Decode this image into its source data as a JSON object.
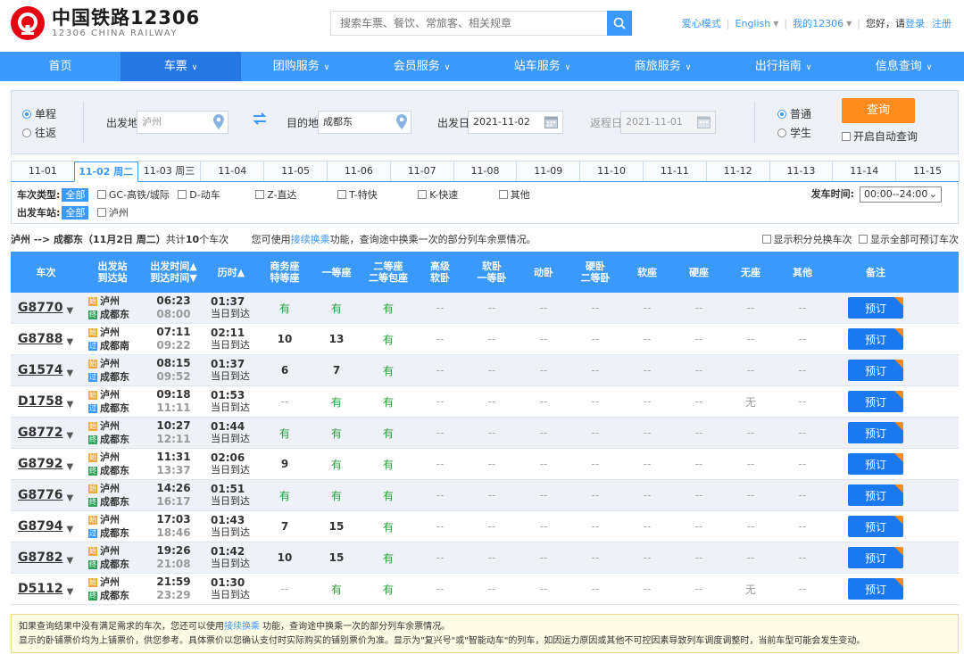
{
  "header": {
    "logo_cn": "中国铁路12306",
    "logo_en": "12306 CHINA RAILWAY",
    "search_placeholder": "搜索车票、餐饮、常旅客、相关规章",
    "links": {
      "care": "爱心模式",
      "english": "English",
      "my12306": "我的12306",
      "hello": "您好，请",
      "login": "登录",
      "register": "注册"
    }
  },
  "nav": [
    {
      "label": "首页",
      "dropdown": false
    },
    {
      "label": "车票",
      "dropdown": true,
      "active": true
    },
    {
      "label": "团购服务",
      "dropdown": true
    },
    {
      "label": "会员服务",
      "dropdown": true
    },
    {
      "label": "站车服务",
      "dropdown": true
    },
    {
      "label": "商旅服务",
      "dropdown": true
    },
    {
      "label": "出行指南",
      "dropdown": true
    },
    {
      "label": "信息查询",
      "dropdown": true
    }
  ],
  "query": {
    "oneway": "单程",
    "roundtrip": "往返",
    "from_label": "出发地",
    "from_value": "泸州",
    "to_label": "目的地",
    "to_value": "成都东",
    "depart_label": "出发日",
    "depart_value": "2021-11-02",
    "return_label": "返程日",
    "return_value": "2021-11-01",
    "normal": "普通",
    "student": "学生",
    "query_btn": "查询",
    "auto_query": "开启自动查询"
  },
  "dates": [
    "11-01",
    "11-02 周二",
    "11-03 周三",
    "11-04",
    "11-05",
    "11-06",
    "11-07",
    "11-08",
    "11-09",
    "11-10",
    "11-11",
    "11-12",
    "11-13",
    "11-14",
    "11-15"
  ],
  "filters": {
    "type_label": "车次类型:",
    "all": "全部",
    "types": [
      "GC-高铁/城际",
      "D-动车",
      "Z-直达",
      "T-特快",
      "K-快速",
      "其他"
    ],
    "station_label": "出发车站:",
    "station": "泸州",
    "time_label": "发车时间:",
    "time_value": "00:00--24:00"
  },
  "summary": {
    "route": "泸州 --> 成都东（11月2日 周二）",
    "count_pre": "共计",
    "count": "10",
    "count_post": "个车次",
    "hint_pre": "您可使用",
    "hint_link": "接续换乘",
    "hint_post": "功能，查询途中换乘一次的部分列车余票情况。",
    "opt1": "显示积分兑换车次",
    "opt2": "显示全部可预订车次"
  },
  "columns": [
    [
      "车次"
    ],
    [
      "出发站",
      "到达站"
    ],
    [
      "出发时间▲",
      "到达时间▼"
    ],
    [
      "历时▲"
    ],
    [
      "商务座",
      "特等座"
    ],
    [
      "一等座"
    ],
    [
      "二等座",
      "二等包座"
    ],
    [
      "高级",
      "软卧"
    ],
    [
      "软卧",
      "一等卧"
    ],
    [
      "动卧"
    ],
    [
      "硬卧",
      "二等卧"
    ],
    [
      "软座"
    ],
    [
      "硬座"
    ],
    [
      "无座"
    ],
    [
      "其他"
    ],
    [
      "备注"
    ]
  ],
  "book_label": "预订",
  "rows": [
    {
      "train": "G8770",
      "from": "泸州",
      "to": "成都东",
      "to_type": "end",
      "dep": "06:23",
      "arr": "08:00",
      "dur": "01:37",
      "arrive": "当日到达",
      "seats": [
        "有",
        "有",
        "有",
        "--",
        "--",
        "--",
        "--",
        "--",
        "--",
        "--",
        "--"
      ]
    },
    {
      "train": "G8788",
      "from": "泸州",
      "to": "成都南",
      "to_type": "pass",
      "dep": "07:11",
      "arr": "09:22",
      "dur": "02:11",
      "arrive": "当日到达",
      "seats": [
        "10",
        "13",
        "有",
        "--",
        "--",
        "--",
        "--",
        "--",
        "--",
        "--",
        "--"
      ]
    },
    {
      "train": "G1574",
      "from": "泸州",
      "to": "成都东",
      "to_type": "pass",
      "dep": "08:15",
      "arr": "09:52",
      "dur": "01:37",
      "arrive": "当日到达",
      "seats": [
        "6",
        "7",
        "有",
        "--",
        "--",
        "--",
        "--",
        "--",
        "--",
        "--",
        "--"
      ]
    },
    {
      "train": "D1758",
      "from": "泸州",
      "to": "成都东",
      "to_type": "pass",
      "dep": "09:18",
      "arr": "11:11",
      "dur": "01:53",
      "arrive": "当日到达",
      "seats": [
        "--",
        "有",
        "有",
        "--",
        "--",
        "--",
        "--",
        "--",
        "--",
        "无",
        "--"
      ]
    },
    {
      "train": "G8772",
      "from": "泸州",
      "to": "成都东",
      "to_type": "end",
      "dep": "10:27",
      "arr": "12:11",
      "dur": "01:44",
      "arrive": "当日到达",
      "seats": [
        "有",
        "有",
        "有",
        "--",
        "--",
        "--",
        "--",
        "--",
        "--",
        "--",
        "--"
      ]
    },
    {
      "train": "G8792",
      "from": "泸州",
      "to": "成都东",
      "to_type": "end",
      "dep": "11:31",
      "arr": "13:37",
      "dur": "02:06",
      "arrive": "当日到达",
      "seats": [
        "9",
        "有",
        "有",
        "--",
        "--",
        "--",
        "--",
        "--",
        "--",
        "--",
        "--"
      ]
    },
    {
      "train": "G8776",
      "from": "泸州",
      "to": "成都东",
      "to_type": "end",
      "dep": "14:26",
      "arr": "16:17",
      "dur": "01:51",
      "arrive": "当日到达",
      "seats": [
        "有",
        "有",
        "有",
        "--",
        "--",
        "--",
        "--",
        "--",
        "--",
        "--",
        "--"
      ]
    },
    {
      "train": "G8794",
      "from": "泸州",
      "to": "成都东",
      "to_type": "pass",
      "dep": "17:03",
      "arr": "18:46",
      "dur": "01:43",
      "arrive": "当日到达",
      "seats": [
        "7",
        "15",
        "有",
        "--",
        "--",
        "--",
        "--",
        "--",
        "--",
        "--",
        "--"
      ]
    },
    {
      "train": "G8782",
      "from": "泸州",
      "to": "成都东",
      "to_type": "end",
      "dep": "19:26",
      "arr": "21:08",
      "dur": "01:42",
      "arrive": "当日到达",
      "seats": [
        "10",
        "15",
        "有",
        "--",
        "--",
        "--",
        "--",
        "--",
        "--",
        "--",
        "--"
      ]
    },
    {
      "train": "D5112",
      "from": "泸州",
      "to": "成都东",
      "to_type": "end",
      "dep": "21:59",
      "arr": "23:29",
      "dur": "01:30",
      "arrive": "当日到达",
      "seats": [
        "--",
        "有",
        "有",
        "--",
        "--",
        "--",
        "--",
        "--",
        "--",
        "无",
        "--"
      ]
    }
  ],
  "notice": {
    "line1_pre": "如果查询结果中没有满足需求的车次，您还可以使用",
    "line1_link": "接续换乘",
    "line1_post": " 功能，查询途中换乘一次的部分列车余票情况。",
    "line2": "显示的卧铺票价均为上铺票价，供您参考。具体票价以您确认支付时实际购买的铺别票价为准。显示为\"复兴号\"或\"智能动车\"的列车，如因运力原因或其他不可控因素导致列车调度调整时，当前车型可能会发生变动。"
  },
  "colors": {
    "primary": "#3b99fc",
    "nav_active": "#2676e3",
    "accent": "#ff8a1d",
    "available": "#2a9d3a",
    "logo_red": "#e60012"
  }
}
